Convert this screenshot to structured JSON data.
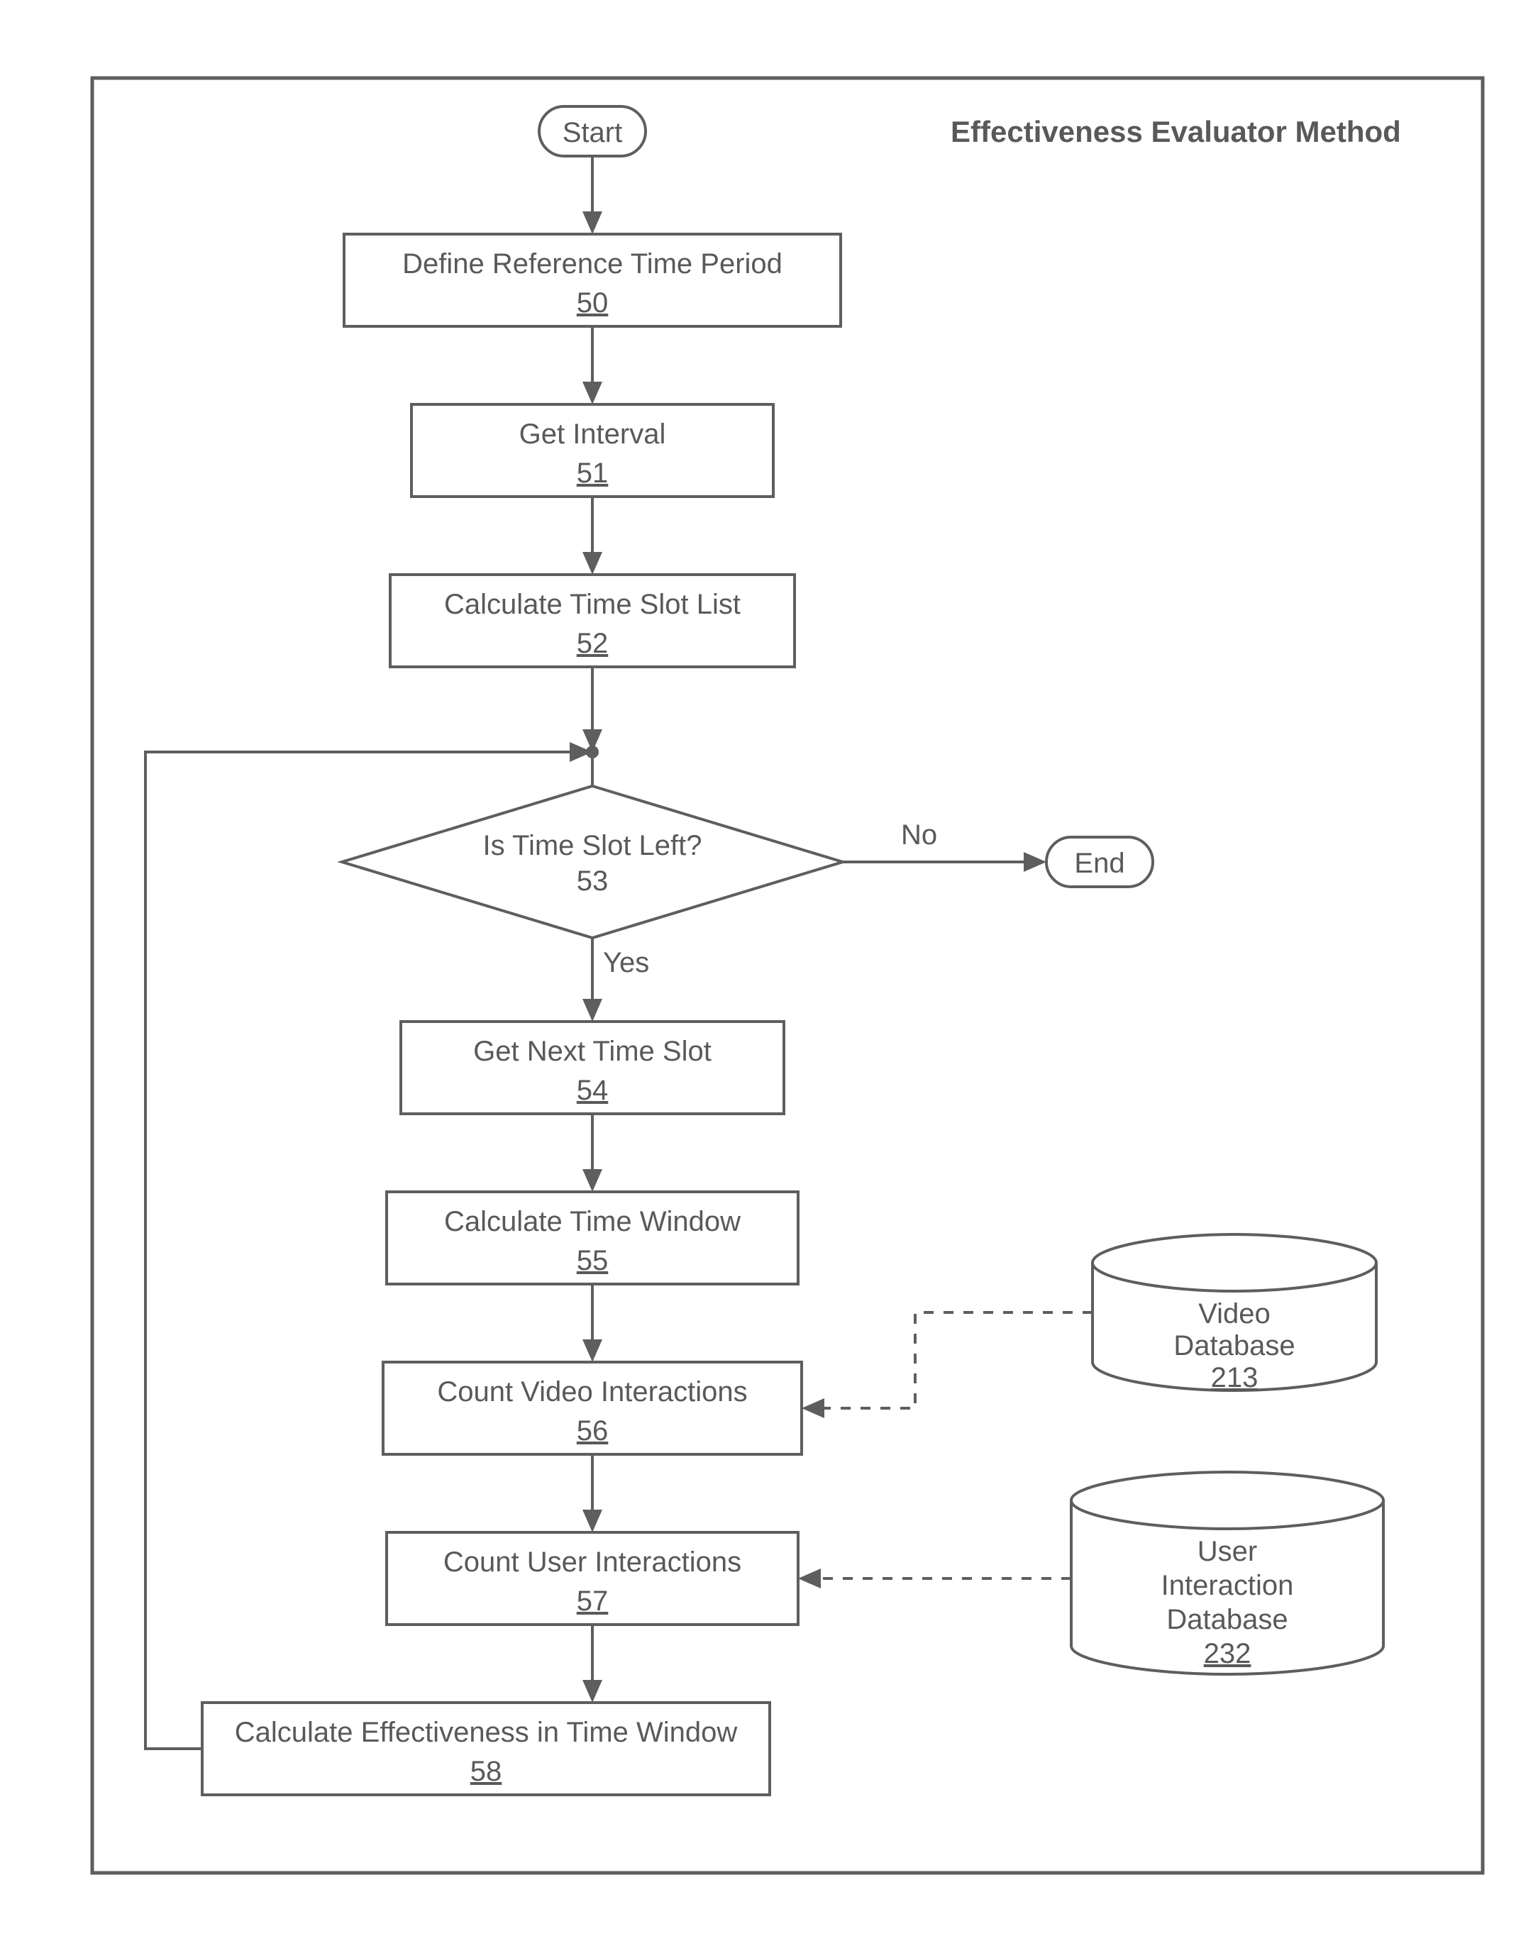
{
  "title": "Effectiveness Evaluator Method",
  "terminals": {
    "start": "Start",
    "end": "End"
  },
  "nodes": {
    "n50": {
      "label": "Define Reference Time Period",
      "ref": "50"
    },
    "n51": {
      "label": "Get Interval",
      "ref": "51"
    },
    "n52": {
      "label": "Calculate Time Slot List",
      "ref": "52"
    },
    "n53": {
      "label": "Is Time Slot Left?",
      "ref": "53"
    },
    "n54": {
      "label": "Get Next Time Slot",
      "ref": "54"
    },
    "n55": {
      "label": "Calculate Time Window",
      "ref": "55"
    },
    "n56": {
      "label": "Count Video Interactions",
      "ref": "56"
    },
    "n57": {
      "label": "Count User Interactions",
      "ref": "57"
    },
    "n58": {
      "label": "Calculate Effectiveness in Time Window",
      "ref": "58"
    }
  },
  "databases": {
    "d213": {
      "line1": "Video",
      "line2": "Database",
      "ref": "213"
    },
    "d232": {
      "line1": "User",
      "line2": "Interaction",
      "line3": "Database",
      "ref": "232"
    }
  },
  "edges": {
    "no": "No",
    "yes": "Yes"
  }
}
